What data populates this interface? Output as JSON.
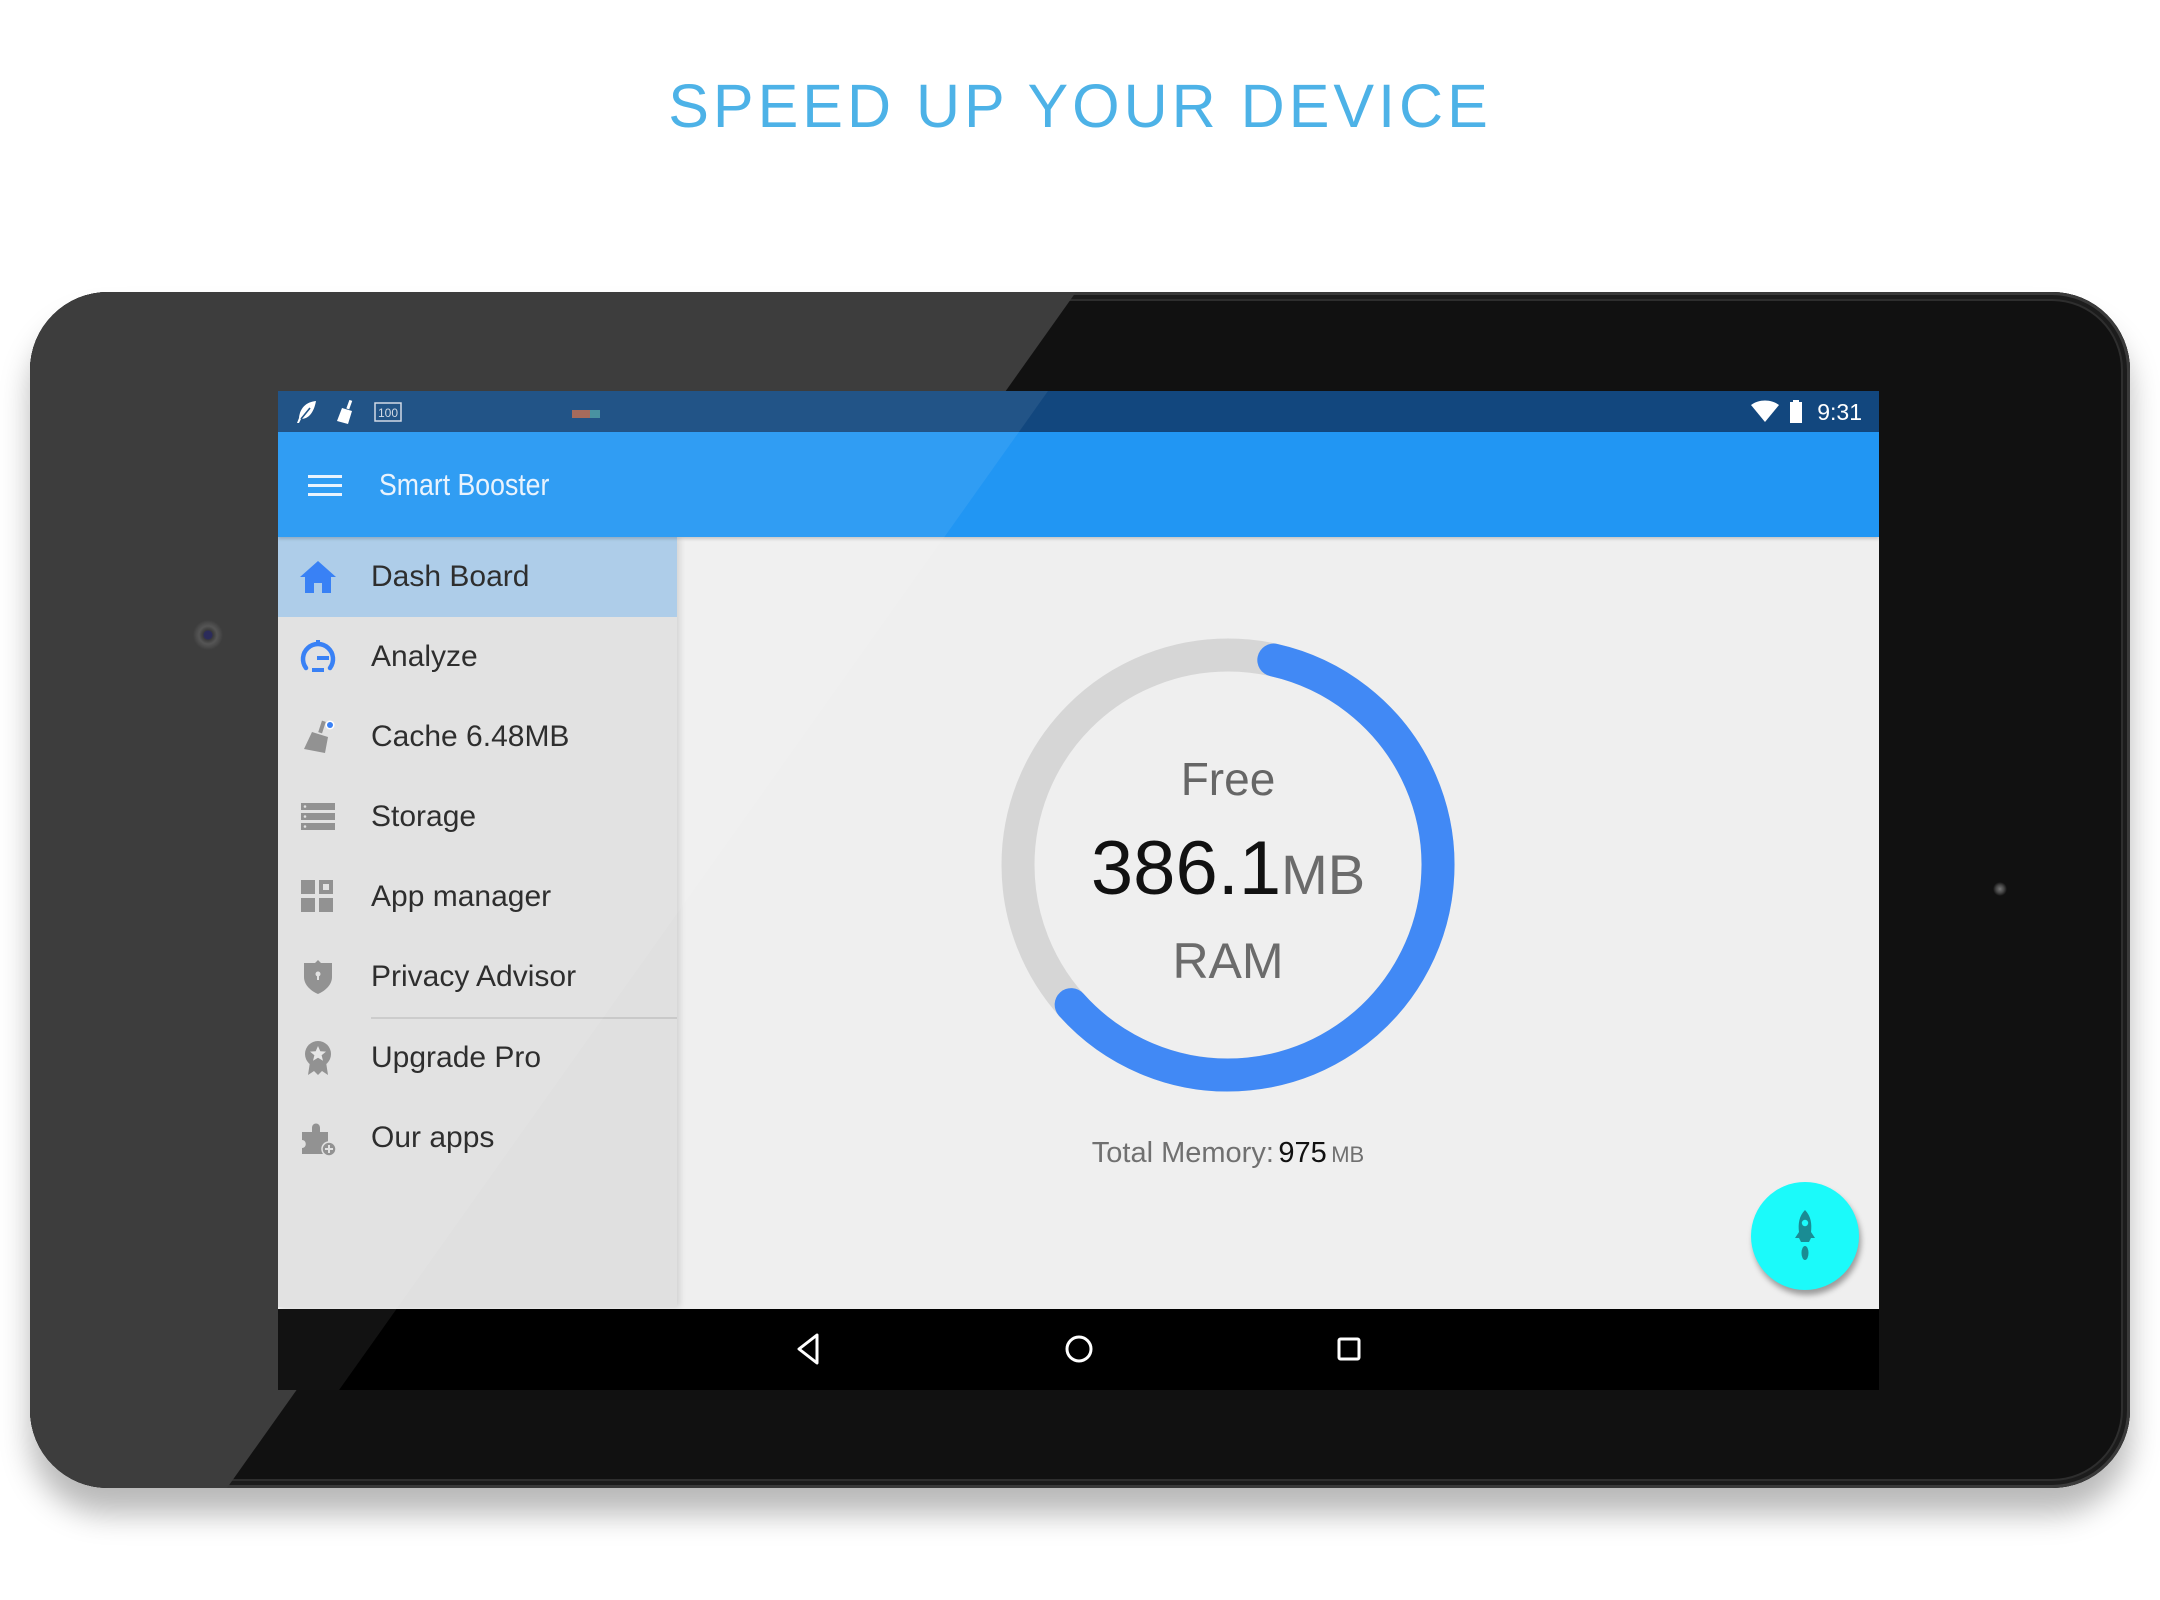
{
  "headline": "SPEED UP YOUR DEVICE",
  "status_bar": {
    "left_icons": [
      "feather-icon",
      "broom-icon",
      "battery-100-icon",
      "notification-indicator"
    ],
    "right_icons": [
      "wifi-icon",
      "battery-icon"
    ],
    "time": "9:31"
  },
  "toolbar": {
    "menu_icon": "hamburger-menu-icon",
    "title": "Smart Booster",
    "color": "#2196F3"
  },
  "drawer": {
    "items": [
      {
        "label": "Dash Board",
        "icon": "home-icon",
        "active": true
      },
      {
        "label": "Analyze",
        "icon": "speedometer-icon",
        "active": false
      },
      {
        "label": "Cache 6.48MB",
        "icon": "broom-icon",
        "active": false
      },
      {
        "label": "Storage",
        "icon": "storage-icon",
        "active": false
      },
      {
        "label": "App manager",
        "icon": "apps-grid-icon",
        "active": false
      },
      {
        "label": "Privacy Advisor",
        "icon": "shield-icon",
        "active": false
      },
      {
        "label": "Upgrade Pro",
        "icon": "award-badge-icon",
        "active": false
      },
      {
        "label": "Our apps",
        "icon": "puzzle-icon",
        "active": false
      }
    ],
    "active_color": "#A8CAE8"
  },
  "dashboard": {
    "free_label": "Free",
    "free_value": "386.1",
    "free_unit": "MB",
    "ram_label": "RAM",
    "total_label": "Total Memory:",
    "total_value": "975",
    "total_unit": "MB",
    "gauge": {
      "free_mb": 386.1,
      "total_mb": 975,
      "used_fraction": 0.604,
      "fill_color": "#4189F5",
      "track_color": "#D6D6D6"
    }
  },
  "fab": {
    "icon": "rocket-icon",
    "color": "#1BFAFA"
  },
  "nav_bar": {
    "buttons": [
      "back-icon",
      "home-circle-icon",
      "recents-icon"
    ]
  }
}
